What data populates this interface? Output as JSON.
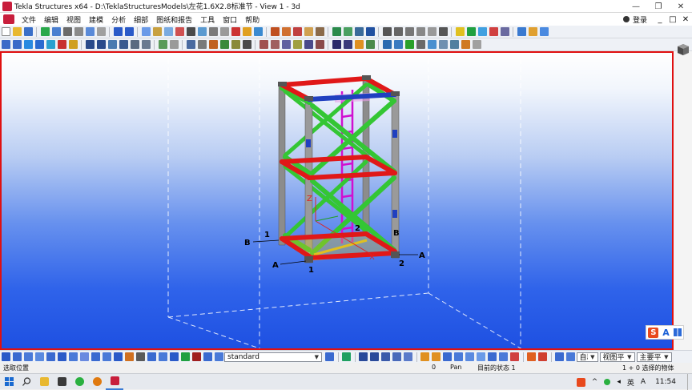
{
  "window": {
    "title": "Tekla Structures x64 - D:\\TeklaStructuresModels\\左花1.6X2.8标准节  - View 1 - 3d",
    "minimize": "—",
    "restore": "❐",
    "close": "✕"
  },
  "menu": {
    "items": [
      "文件",
      "编辑",
      "视图",
      "建模",
      "分析",
      "细部",
      "图纸和报告",
      "工具",
      "窗口",
      "帮助"
    ],
    "login": "登录",
    "mini_min": "_",
    "mini_max": "□",
    "mini_close": "✕"
  },
  "viewport": {
    "labels": {
      "b_left": "B",
      "one_left": "1",
      "a_left": "A",
      "one_bottom": "1",
      "two_center": "2",
      "b_right": "B",
      "two_right": "2",
      "a_right": "A",
      "z_axis": "Z",
      "x_axis": "X"
    }
  },
  "ime": {
    "s": "S",
    "a": "A"
  },
  "bottom_toolbar": {
    "profile_select": "standard",
    "snap_select": "自动",
    "plane_select": "视图平面",
    "main_select": "主要平面"
  },
  "statusbar": {
    "left": "选取位置",
    "count": "0",
    "mode": "Pan",
    "state": "目前的状态 1",
    "selection": "1 + 0 选择的物体"
  },
  "taskbar": {
    "clock": "11:54",
    "ime_indicator": "英",
    "lang": "A"
  },
  "colors": {
    "viewport_border": "#e01010",
    "beam_red": "#e01818",
    "brace_green": "#34c634",
    "column_gray": "#8a8a8a",
    "ladder_magenta": "#d010d0",
    "beam_blue": "#2040c0",
    "plate_yellow": "#e0c020"
  }
}
